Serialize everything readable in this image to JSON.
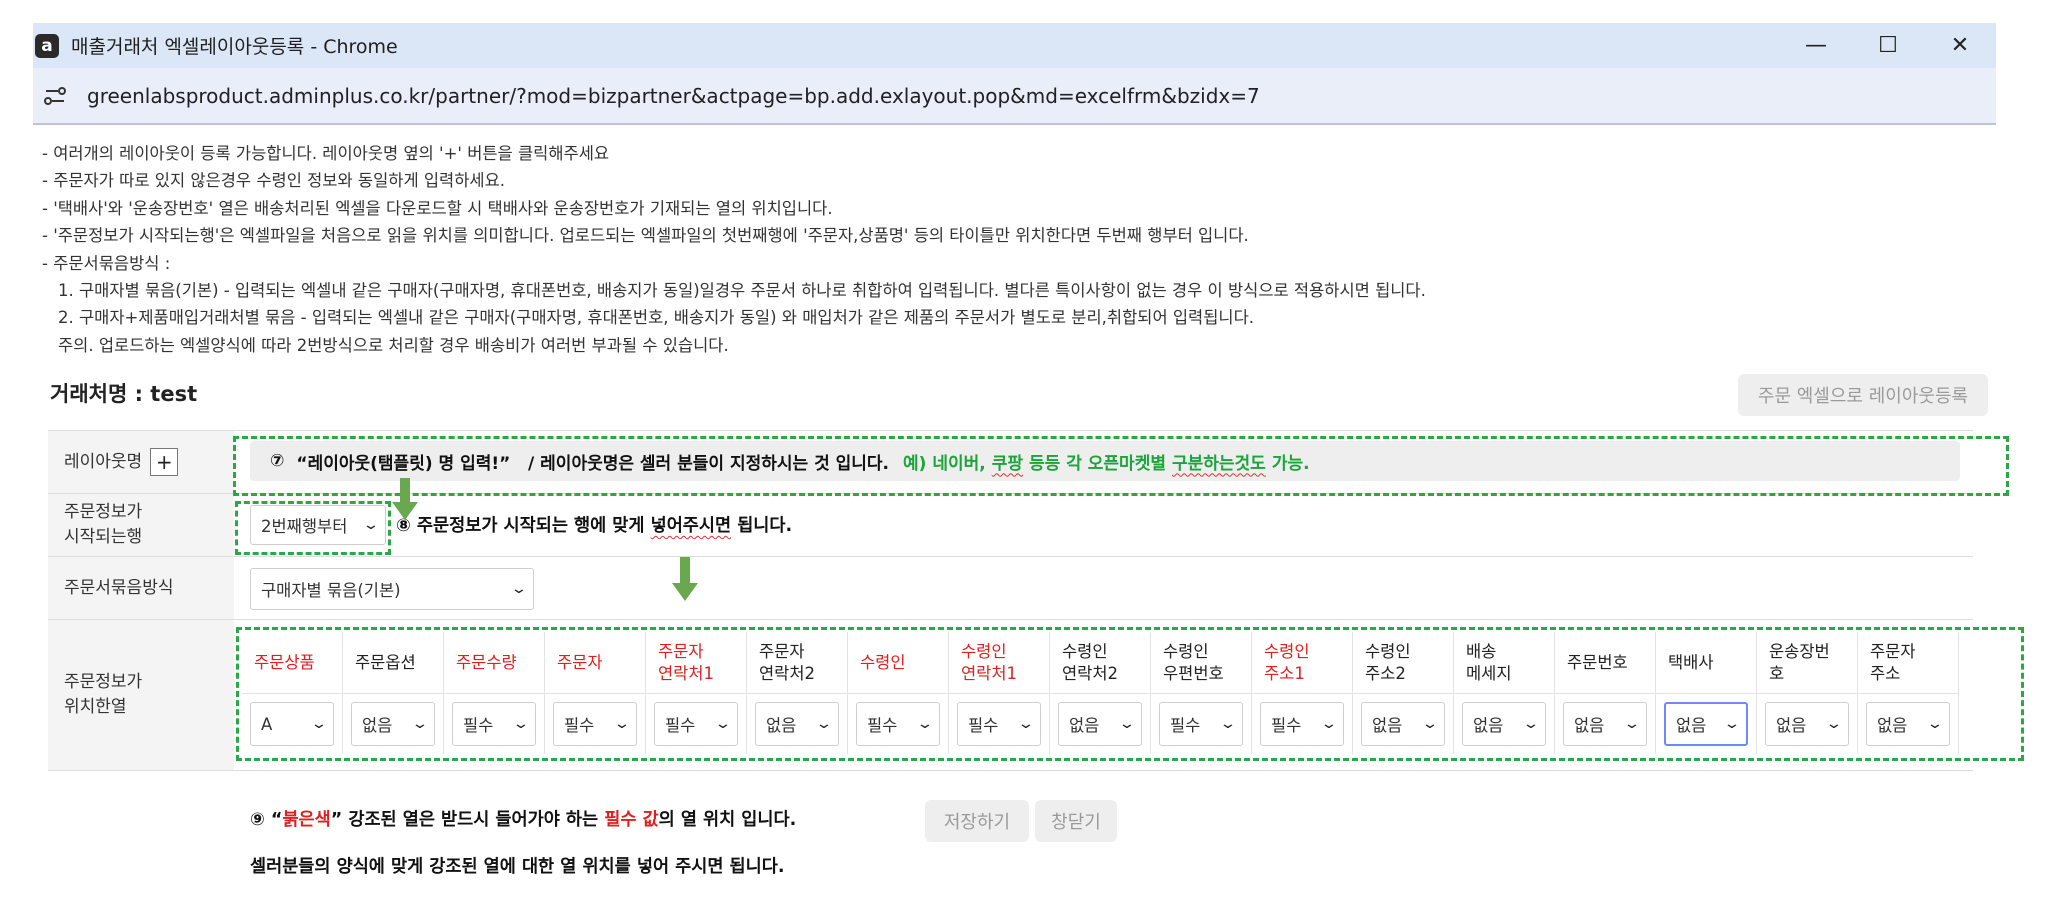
{
  "window": {
    "title": "매출거래처 엑셀레이아웃등록 - Chrome",
    "app_icon": "a",
    "url": "greenlabsproduct.adminplus.co.kr/partner/?mod=bizpartner&actpage=bp.add.exlayout.pop&md=excelfrm&bzidx=7",
    "minimize": "—",
    "maximize": "☐",
    "close": "✕"
  },
  "notes": [
    "- 여러개의 레이아웃이 등록 가능합니다. 레이아웃명 옆의 '+' 버튼을 클릭해주세요",
    "- 주문자가 따로 있지 않은경우 수령인 정보와 동일하게 입력하세요.",
    "- '택배사'와 '운송장번호' 열은 배송처리된 엑셀을 다운로드할 시 택배사와 운송장번호가 기재되는 열의 위치입니다.",
    "- '주문정보가 시작되는행'은 엑셀파일을 처음으로 읽을 위치를 의미합니다. 업로드되는 엑셀파일의 첫번째행에 '주문자,상품명' 등의 타이틀만 위치한다면 두번째 행부터 입니다.",
    "- 주문서묶음방식 :",
    "   1. 구매자별 묶음(기본) - 입력되는 엑셀내 같은 구매자(구매자명, 휴대폰번호, 배송지가 동일)일경우 주문서 하나로 취합하여 입력됩니다. 별다른 특이사항이 없는 경우 이 방식으로 적용하시면 됩니다.",
    "   2. 구매자+제품매입거래처별 묶음 - 입력되는 엑셀내 같은 구매자(구매자명, 휴대폰번호, 배송지가 동일) 와 매입처가 같은 제품의 주문서가 별도로 분리,취합되어 입력됩니다.",
    "   주의. 업로드하는 엑셀양식에 따라 2번방식으로 처리할 경우 배송비가 여러번 부과될 수 있습니다."
  ],
  "partner_label": "거래처명 : test",
  "excel_button": "주문 엑셀으로 레이아웃등록",
  "form": {
    "layout_label": "레이아웃명",
    "plus": "+",
    "layout_input": {
      "num": "⑦",
      "main": "“레이아웃(탬플릿) 명 입력!”   / 레이아웃명은 셀러 분들이 지정하시는 것 입니다.",
      "green_a": "예) 네이버,",
      "green_b": "쿠팡",
      "green_c": "등등 각 오픈마켓별",
      "green_d": "구분하는것도",
      "green_e": "가능."
    },
    "start_row_label_1": "주문정보가",
    "start_row_label_2": "시작되는행",
    "start_row_value": "2번째행부터",
    "start_row_note_num": "⑧",
    "start_row_note_a": "주문정보가 시작되는 행에 맞게",
    "start_row_note_b": "넣어주시면",
    "start_row_note_c": "됩니다.",
    "bundle_label": "주문서묶음방식",
    "bundle_value": "구매자별 묶음(기본)",
    "position_label_1": "주문정보가",
    "position_label_2": "위치한열",
    "columns": [
      {
        "h1": "주문상품",
        "h2": "",
        "req": true,
        "v": "A"
      },
      {
        "h1": "주문옵션",
        "h2": "",
        "req": false,
        "v": "없음"
      },
      {
        "h1": "주문수량",
        "h2": "",
        "req": true,
        "v": "필수"
      },
      {
        "h1": "주문자",
        "h2": "",
        "req": true,
        "v": "필수"
      },
      {
        "h1": "주문자",
        "h2": "연락처1",
        "req": true,
        "v": "필수"
      },
      {
        "h1": "주문자",
        "h2": "연락처2",
        "req": false,
        "v": "없음"
      },
      {
        "h1": "수령인",
        "h2": "",
        "req": true,
        "v": "필수"
      },
      {
        "h1": "수령인",
        "h2": "연락처1",
        "req": true,
        "v": "필수"
      },
      {
        "h1": "수령인",
        "h2": "연락처2",
        "req": false,
        "v": "없음"
      },
      {
        "h1": "수령인",
        "h2": "우편번호",
        "req": false,
        "v": "필수"
      },
      {
        "h1": "수령인",
        "h2": "주소1",
        "req": true,
        "v": "필수"
      },
      {
        "h1": "수령인",
        "h2": "주소2",
        "req": false,
        "v": "없음"
      },
      {
        "h1": "배송",
        "h2": "메세지",
        "req": false,
        "v": "없음"
      },
      {
        "h1": "주문번호",
        "h2": "",
        "req": false,
        "v": "없음"
      },
      {
        "h1": "택배사",
        "h2": "",
        "req": false,
        "v": "없음"
      },
      {
        "h1": "운송장번",
        "h2": "호",
        "req": false,
        "v": "없음"
      },
      {
        "h1": "주문자",
        "h2": "주소",
        "req": false,
        "v": "없음"
      }
    ]
  },
  "bottom": {
    "num": "⑨",
    "line1_a": "“",
    "line1_red1": "붉은색",
    "line1_b": "” 강조된 열은 받드시 들어가야 하는",
    "line1_red2": "필수 값",
    "line1_c": "의 열 위치 입니다.",
    "line2": "셀러분들의 양식에 맞게 강조된 열에 대한 열 위치를 넣어 주시면 됩니다.",
    "save": "저장하기",
    "close": "창닫기"
  },
  "colors": {
    "accent_green": "#2aa845",
    "required_red": "#e02020",
    "titlebar": "#dbe6f7"
  }
}
